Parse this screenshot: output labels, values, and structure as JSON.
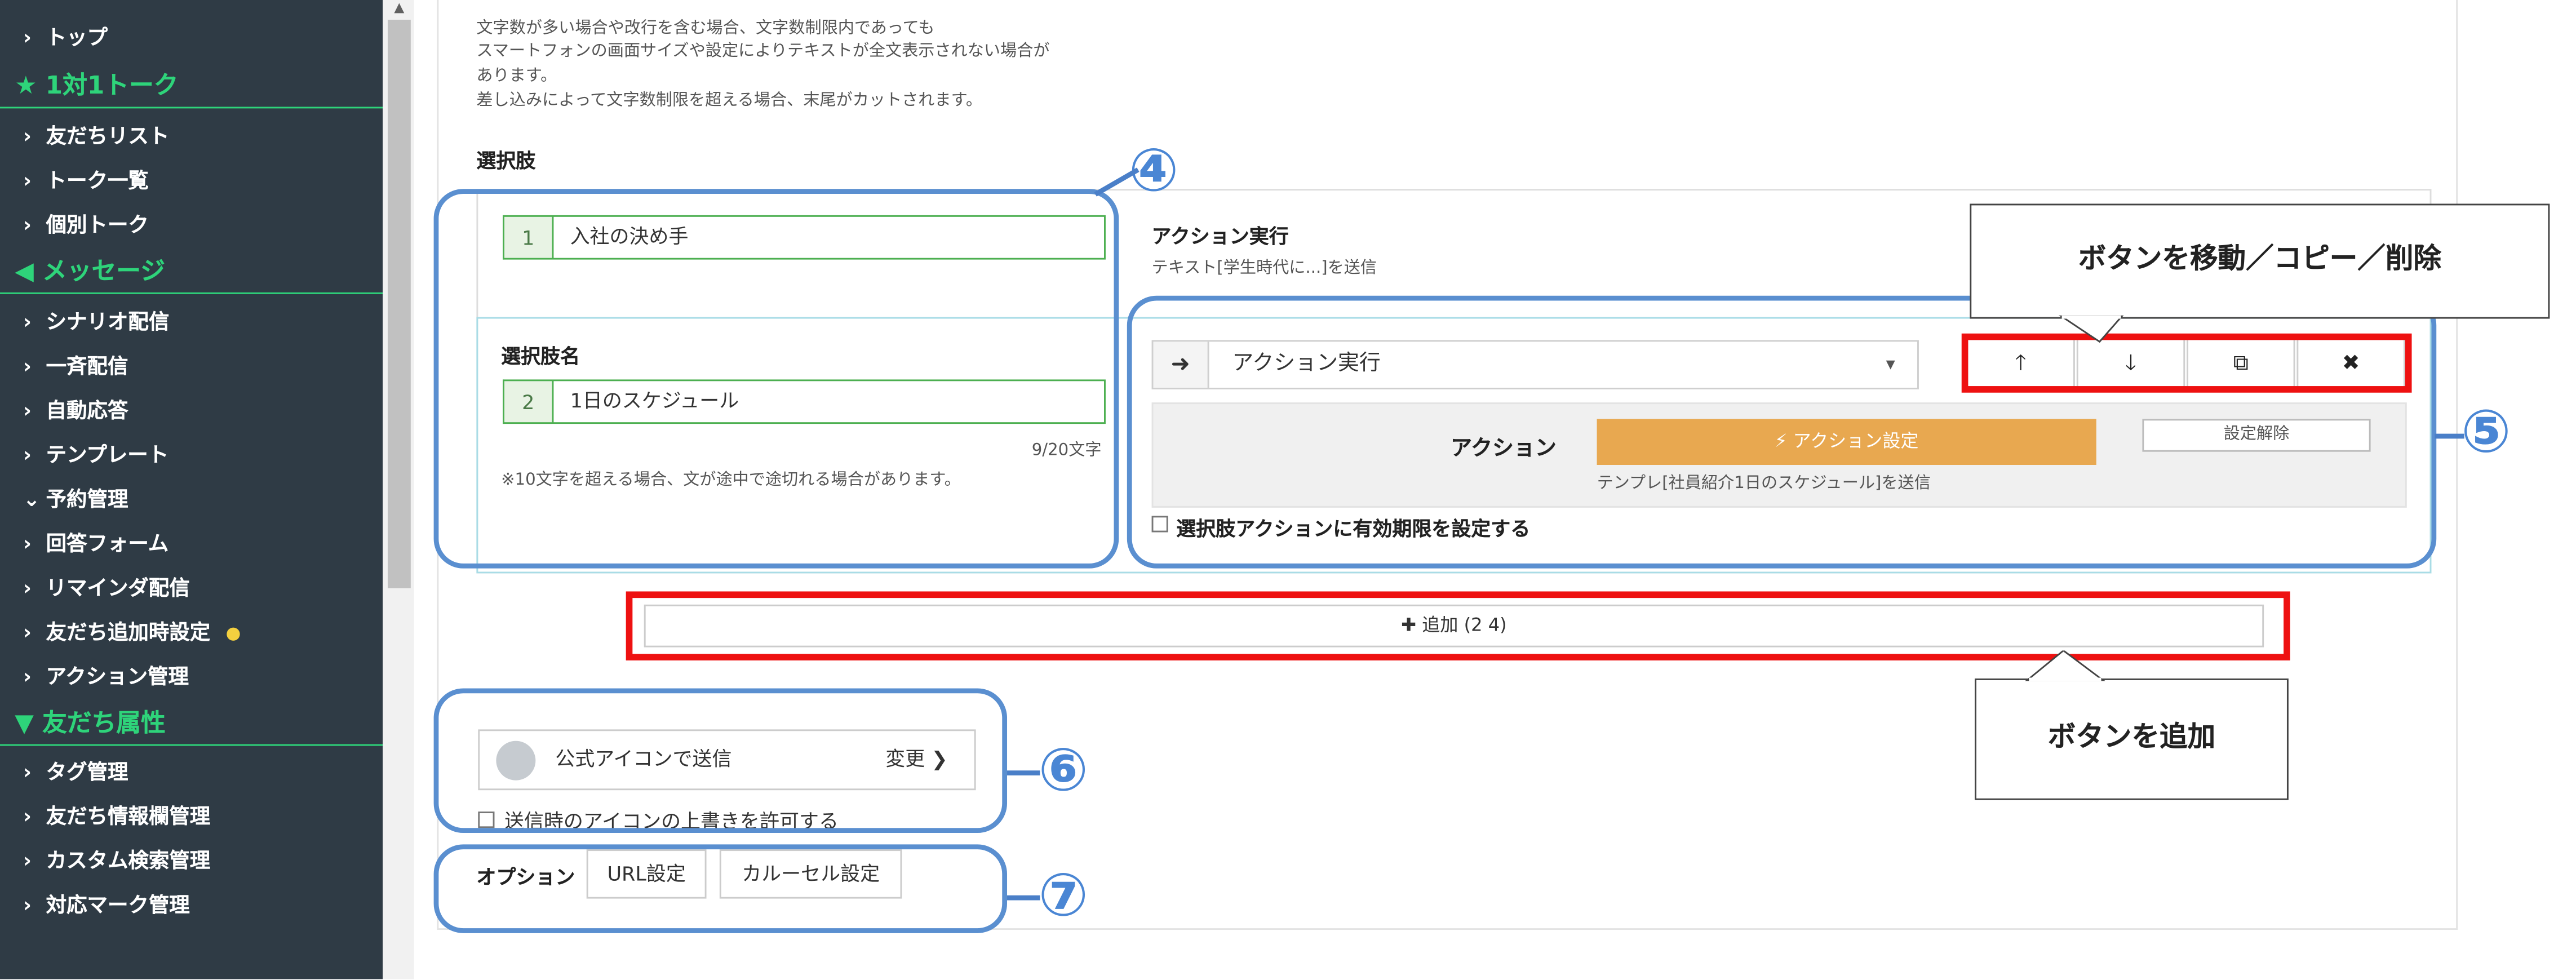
{
  "sidebar": {
    "items": [
      {
        "label": "トップ",
        "kind": "item",
        "icon": "chevron-right"
      },
      {
        "label": "1対1トーク",
        "kind": "section",
        "icon": "star-icon"
      },
      {
        "label": "友だちリスト",
        "kind": "item",
        "icon": "chevron-right"
      },
      {
        "label": "トーク一覧",
        "kind": "item",
        "icon": "chevron-right"
      },
      {
        "label": "個別トーク",
        "kind": "item",
        "icon": "chevron-right"
      },
      {
        "label": "メッセージ",
        "kind": "section",
        "icon": "megaphone-icon"
      },
      {
        "label": "シナリオ配信",
        "kind": "item",
        "icon": "chevron-right"
      },
      {
        "label": "一斉配信",
        "kind": "item",
        "icon": "chevron-right"
      },
      {
        "label": "自動応答",
        "kind": "item",
        "icon": "chevron-right"
      },
      {
        "label": "テンプレート",
        "kind": "item",
        "icon": "chevron-right"
      },
      {
        "label": "予約管理",
        "kind": "item",
        "icon": "chevron-down"
      },
      {
        "label": "回答フォーム",
        "kind": "item",
        "icon": "chevron-right"
      },
      {
        "label": "リマインダ配信",
        "kind": "item",
        "icon": "chevron-right"
      },
      {
        "label": "友だち追加時設定",
        "kind": "item",
        "icon": "chevron-right",
        "badge": "yellow-dot"
      },
      {
        "label": "アクション管理",
        "kind": "item",
        "icon": "chevron-right"
      },
      {
        "label": "友だち属性",
        "kind": "section",
        "icon": "filter-icon"
      },
      {
        "label": "タグ管理",
        "kind": "item",
        "icon": "chevron-right"
      },
      {
        "label": "友だち情報欄管理",
        "kind": "item",
        "icon": "chevron-right"
      },
      {
        "label": "カスタム検索管理",
        "kind": "item",
        "icon": "chevron-right"
      },
      {
        "label": "対応マーク管理",
        "kind": "item",
        "icon": "chevron-right"
      }
    ]
  },
  "notes": [
    "文字数が多い場合や改行を含む場合、文字数制限内であっても",
    "スマートフォンの画面サイズや設定によりテキストが全文表示されない場合が",
    "あります。",
    "差し込みによって文字数制限を超える場合、末尾がカットされます。"
  ],
  "choices": {
    "heading": "選択肢",
    "choice1": {
      "number": "1",
      "value": "入社の決め手",
      "action_title": "アクション実行",
      "action_desc": "テキスト[学生時代に...]を送信"
    },
    "choice2": {
      "name_label": "選択肢名",
      "number": "2",
      "value": "1日のスケジュール",
      "counter": "9/20文字",
      "hint": "※10文字を超える場合、文が途中で途切れる場合があります。"
    }
  },
  "action_panel": {
    "select_value": "アクション実行",
    "action_label": "アクション",
    "action_button": "アクション設定",
    "clear_button": "設定解除",
    "template_note": "テンプレ[社員紹介1日のスケジュール]を送信",
    "expiry_checkbox": "選択肢アクションに有効期限を設定する"
  },
  "controls": {
    "up_icon": "arrow-up-icon",
    "down_icon": "arrow-down-icon",
    "copy_icon": "copy-icon",
    "delete_icon": "close-icon"
  },
  "add_button": {
    "label": "追加 (2 4)"
  },
  "sender": {
    "label": "公式アイコンで送信",
    "change": "変更",
    "override_checkbox": "送信時のアイコンの上書きを許可する"
  },
  "options": {
    "label": "オプション",
    "url_button": "URL設定",
    "carousel_button": "カルーセル設定"
  },
  "annotations": {
    "n4": "④",
    "n5": "⑤",
    "n6": "⑥",
    "n7": "⑦",
    "callout_move": "ボタンを移動／コピー／削除",
    "callout_add": "ボタンを追加"
  },
  "colors": {
    "sidebar_bg": "#2f3b45",
    "section_green": "#2ed47a",
    "accent_orange": "#e8a850",
    "highlight_red": "#e11111",
    "annotation_blue": "#5a8fd0"
  }
}
